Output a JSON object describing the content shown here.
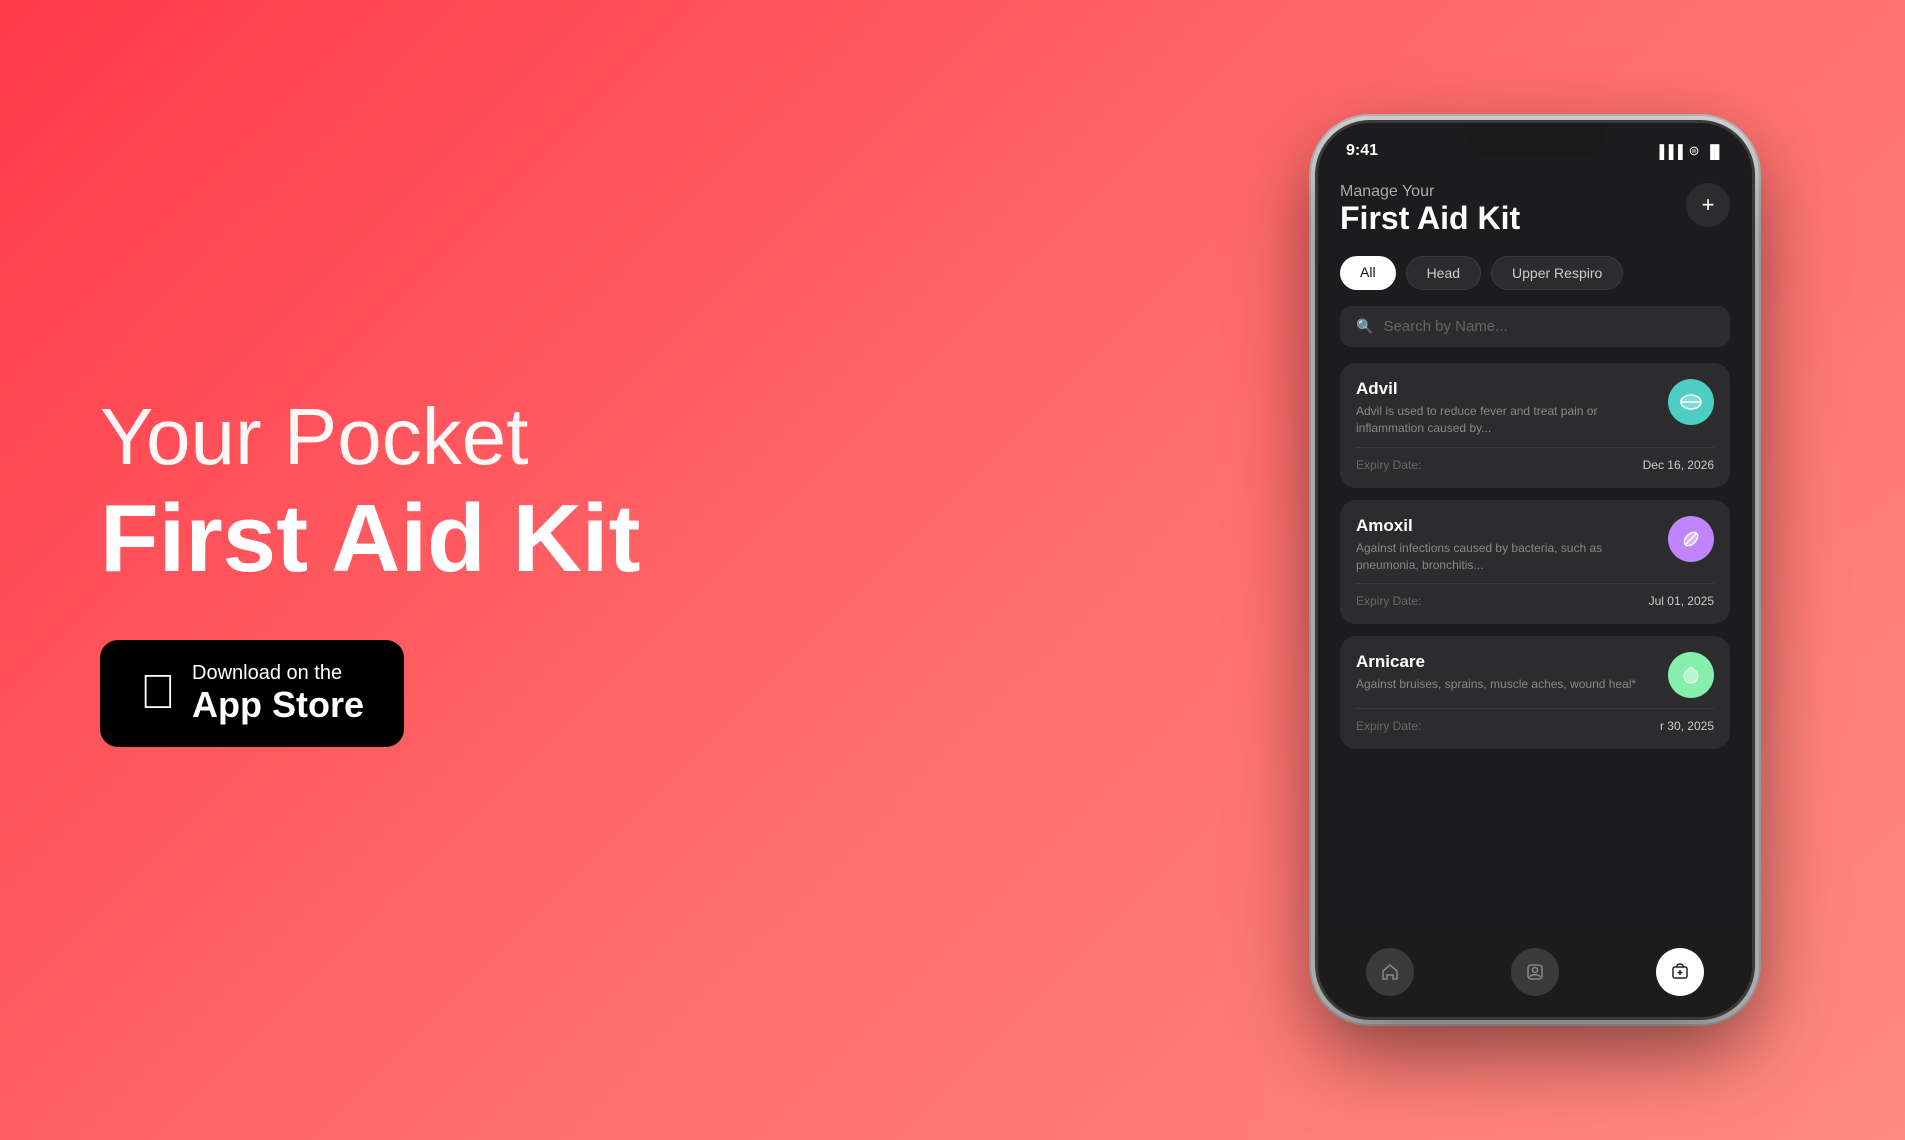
{
  "background": {
    "gradient_start": "#ff3a4a",
    "gradient_end": "#ff8a80"
  },
  "left": {
    "headline_top": "Your Pocket",
    "headline_bottom": "First Aid Kit",
    "app_store": {
      "top_line": "Download on the",
      "bottom_line": "App Store"
    }
  },
  "phone": {
    "status_bar": {
      "time": "9:41",
      "signal": "●●●",
      "wifi": "wifi",
      "battery": "battery"
    },
    "app": {
      "title_sub": "Manage Your",
      "title_main": "First Aid Kit",
      "add_button": "+",
      "categories": [
        {
          "label": "All",
          "active": true
        },
        {
          "label": "Head",
          "active": false
        },
        {
          "label": "Upper Respiro",
          "active": false
        }
      ],
      "search_placeholder": "Search by Name...",
      "medicines": [
        {
          "name": "Advil",
          "description": "Advil is used to reduce fever and treat pain or inflammation caused by...",
          "expiry_label": "Expiry Date:",
          "expiry_date": "Dec 16, 2026",
          "icon": "💊",
          "icon_color": "teal"
        },
        {
          "name": "Amoxil",
          "description": "Against infections caused by bacteria, such as pneumonia, bronchitis...",
          "expiry_label": "Expiry Date:",
          "expiry_date": "Jul 01, 2025",
          "icon": "💊",
          "icon_color": "purple"
        },
        {
          "name": "Arnicare",
          "description": "Against bruises, sprains, muscle aches, wound heal*",
          "expiry_label": "Expiry Date:",
          "expiry_date": "r 30, 2025",
          "icon": "🌿",
          "icon_color": "green"
        }
      ]
    }
  }
}
